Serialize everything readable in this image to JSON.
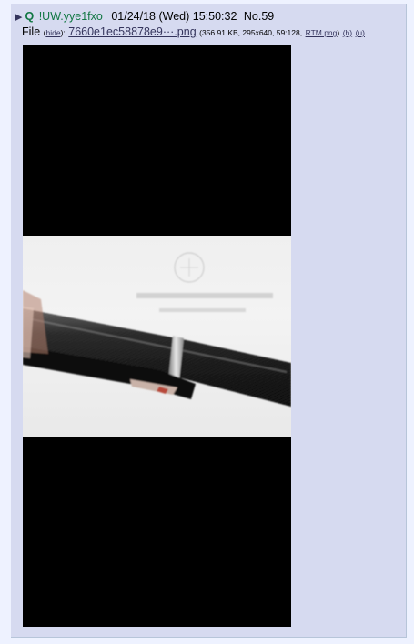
{
  "post": {
    "menu_arrow": "▶",
    "name": "Q",
    "tripcode": "!UW.yye1fxo",
    "date": "01/24/18 (Wed) 15:50:32",
    "number": "No.59"
  },
  "file": {
    "prefix": "File",
    "hide_open": "(",
    "hide_label": "hide",
    "hide_close": "):",
    "filename": "7660e1ec58878e9···.png",
    "meta": "(356.91 KB, 295x640, 59:128,",
    "original_name": "RTM.png",
    "meta_close": ")",
    "h_label": "(h)",
    "u_label": "(u)"
  },
  "colors": {
    "name": "#117743",
    "link": "#34345c",
    "post_bg": "#d6daf0",
    "page_bg": "#eef2ff"
  }
}
